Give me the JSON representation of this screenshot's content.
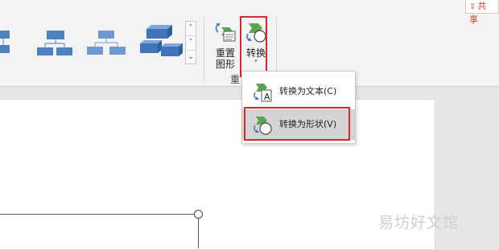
{
  "ribbon": {
    "gallery_layouts": [
      "hierarchy-horizontal",
      "hierarchy-org",
      "hierarchy-tree",
      "hierarchy-3d-blocks"
    ],
    "gallery_scroll": {
      "up": "˄",
      "down": "˅",
      "more": "⌄"
    },
    "reset_button": {
      "line1": "重置",
      "line2": "图形",
      "icon": "reset-graphic-icon"
    },
    "convert_button": {
      "label": "转换",
      "arrow": "˅",
      "icon": "convert-icon"
    },
    "group_label": "重",
    "share": {
      "icon": "share-icon",
      "label": "共享"
    }
  },
  "convert_menu": {
    "items": [
      {
        "label": "转换为文本(C)",
        "icon": "convert-to-text-icon",
        "highlighted": false
      },
      {
        "label": "转换为形状(V)",
        "icon": "convert-to-shapes-icon",
        "highlighted": true
      }
    ]
  },
  "watermark": "易坊好文馆",
  "colors": {
    "accent_red": "#d6272c",
    "shape_blue": "#4f81bd",
    "green": "#4c9a4c"
  }
}
